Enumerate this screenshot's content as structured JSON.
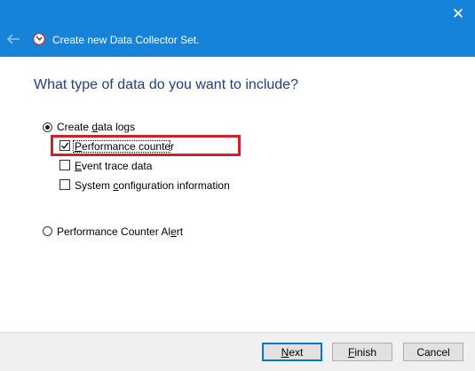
{
  "window": {
    "title": "Create new Data Collector Set.",
    "close_symbol": "✕",
    "back_icon": "arrow-left-icon",
    "app_icon": "performance-monitor-icon"
  },
  "heading": "What type of data do you want to include?",
  "options": {
    "create_logs": {
      "pre": "Create ",
      "accel": "d",
      "post": "ata logs",
      "selected": true
    },
    "performance_counter": {
      "pre": "",
      "accel": "P",
      "post": "erformance counter",
      "checked": true
    },
    "event_trace": {
      "pre": "",
      "accel": "E",
      "post": "vent trace data",
      "checked": false
    },
    "system_config": {
      "pre": "System ",
      "accel": "c",
      "post": "onfiguration information",
      "checked": false
    },
    "counter_alert": {
      "pre": "Performance Counter Al",
      "accel": "e",
      "post": "rt",
      "selected": false
    }
  },
  "buttons": {
    "next": {
      "pre": "",
      "accel": "N",
      "post": "ext"
    },
    "finish": {
      "pre": "",
      "accel": "F",
      "post": "inish"
    },
    "cancel": {
      "label": "Cancel"
    }
  },
  "colors": {
    "titlebar": "#1683d8",
    "highlight": "#d0202a",
    "heading": "#1f3f87"
  }
}
